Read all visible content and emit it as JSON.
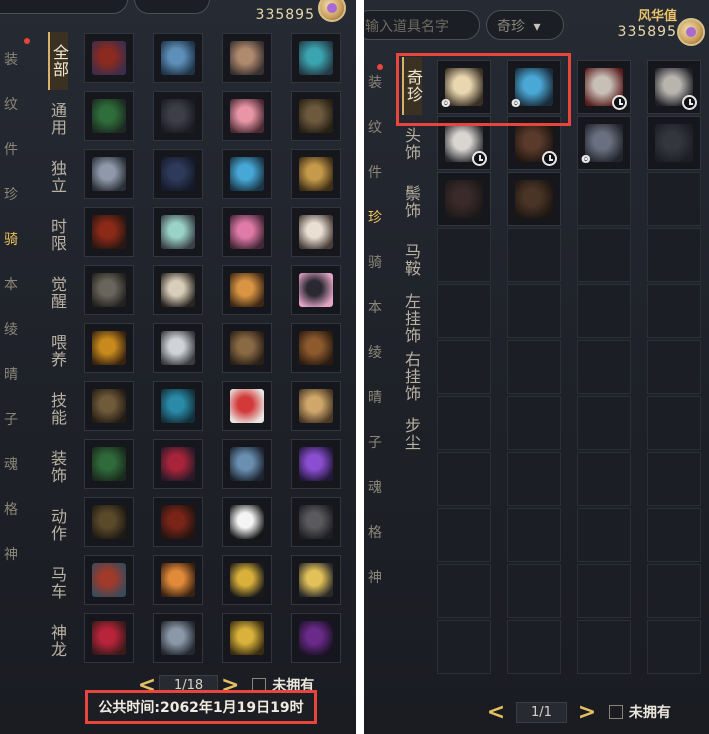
{
  "left": {
    "fengcai_value": "335895",
    "edge_labels": [
      "装",
      "纹",
      "件",
      "珍",
      "骑",
      "本",
      "绫",
      "晴",
      "子",
      "魂",
      "格",
      "神"
    ],
    "categories": [
      "全部",
      "通用",
      "独立",
      "时限",
      "觉醒",
      "喂养",
      "技能",
      "装饰",
      "动作",
      "马车",
      "神龙"
    ],
    "pager": {
      "prev": "<",
      "text": "1/18",
      "next": ">",
      "checkbox_label": "未拥有"
    },
    "public_time": "公共时间:2062年1月19日19时",
    "items": [
      {
        "icon": "mount-icon",
        "c1": "#8b2a1f",
        "c2": "#3d2d4a"
      },
      {
        "icon": "mount-icon",
        "c1": "#5e8fb8",
        "c2": "#20344a"
      },
      {
        "icon": "mount-icon",
        "c1": "#b08a6e",
        "c2": "#3a3030"
      },
      {
        "icon": "mount-icon",
        "c1": "#3aa5b0",
        "c2": "#243a46"
      },
      {
        "icon": "mount-icon",
        "c1": "#2f6e3a",
        "c2": "#1c2a22"
      },
      {
        "icon": "mount-icon",
        "c1": "#3d3f48",
        "c2": "#1a1b20"
      },
      {
        "icon": "mount-icon",
        "c1": "#e895a6",
        "c2": "#4a2a32"
      },
      {
        "icon": "mount-icon",
        "c1": "#6d5a3e",
        "c2": "#262014"
      },
      {
        "icon": "mount-icon",
        "c1": "#8f99aa",
        "c2": "#2b3038"
      },
      {
        "icon": "mount-icon",
        "c1": "#2e3a5a",
        "c2": "#151a28"
      },
      {
        "icon": "mount-icon",
        "c1": "#47a7d6",
        "c2": "#1a3646"
      },
      {
        "icon": "mount-icon",
        "c1": "#c59a4a",
        "c2": "#3e2e16"
      },
      {
        "icon": "mount-icon",
        "c1": "#8c2a18",
        "c2": "#2a1612"
      },
      {
        "icon": "mount-icon",
        "c1": "#9ad2c6",
        "c2": "#3a4248"
      },
      {
        "icon": "mount-icon",
        "c1": "#e07aa8",
        "c2": "#452636"
      },
      {
        "icon": "mount-icon",
        "c1": "#e9dfd2",
        "c2": "#4a3e3a"
      },
      {
        "icon": "mount-icon",
        "c1": "#6a655c",
        "c2": "#24221e"
      },
      {
        "icon": "mount-icon",
        "c1": "#d8cdb8",
        "c2": "#2a2622"
      },
      {
        "icon": "mount-icon",
        "c1": "#d99544",
        "c2": "#3e2814"
      },
      {
        "icon": "mount-icon",
        "c1": "#2a2830",
        "c2": "#e3a6c8"
      },
      {
        "icon": "mount-icon",
        "c1": "#c88a1c",
        "c2": "#3a2410"
      },
      {
        "icon": "mount-icon",
        "c1": "#cfd2d6",
        "c2": "#3a3c42"
      },
      {
        "icon": "mount-icon",
        "c1": "#8a6a44",
        "c2": "#2a2016"
      },
      {
        "icon": "mount-icon",
        "c1": "#8d5a2e",
        "c2": "#2c1c10"
      },
      {
        "icon": "mount-icon",
        "c1": "#6f5a3a",
        "c2": "#241c14"
      },
      {
        "icon": "mount-icon",
        "c1": "#2a8aa8",
        "c2": "#13303a"
      },
      {
        "icon": "mount-icon",
        "c1": "#d23a3a",
        "c2": "#e9e6e2"
      },
      {
        "icon": "mount-icon",
        "c1": "#cfa76a",
        "c2": "#4a3826"
      },
      {
        "icon": "mount-icon",
        "c1": "#2f6a3a",
        "c2": "#1a2a1c"
      },
      {
        "icon": "mount-icon",
        "c1": "#a8243a",
        "c2": "#2a1a28"
      },
      {
        "icon": "mount-icon",
        "c1": "#6a8fb0",
        "c2": "#1c2430"
      },
      {
        "icon": "mount-icon",
        "c1": "#8a4ed0",
        "c2": "#22183a"
      },
      {
        "icon": "mount-icon",
        "c1": "#5a4a2a",
        "c2": "#1e1a14"
      },
      {
        "icon": "mount-icon",
        "c1": "#7a2418",
        "c2": "#221410"
      },
      {
        "icon": "mount-icon",
        "c1": "#f4f4f4",
        "c2": "#161616"
      },
      {
        "icon": "mount-icon",
        "c1": "#5a5a5e",
        "c2": "#1e1e22"
      },
      {
        "icon": "mount-icon",
        "c1": "#a03a2a",
        "c2": "#3a4a5a"
      },
      {
        "icon": "mount-icon",
        "c1": "#e08a3a",
        "c2": "#3a2212"
      },
      {
        "icon": "mount-icon",
        "c1": "#d9b13a",
        "c2": "#1a1a1a"
      },
      {
        "icon": "mount-icon",
        "c1": "#e3c15a",
        "c2": "#2a2a2a"
      },
      {
        "icon": "mount-icon",
        "c1": "#b8243a",
        "c2": "#3a1a1a"
      },
      {
        "icon": "mount-icon",
        "c1": "#8a98a8",
        "c2": "#242830"
      },
      {
        "icon": "mount-icon",
        "c1": "#d8b23a",
        "c2": "#3a2e12"
      },
      {
        "icon": "mount-icon",
        "c1": "#6a2a8a",
        "c2": "#1c1226"
      }
    ]
  },
  "right": {
    "search_placeholder": "输入道具名字",
    "filter": "奇珍",
    "filter_arrow": "▾",
    "fengcai_label": "风华值",
    "fengcai_value": "335895",
    "edge_labels": [
      "装",
      "纹",
      "件",
      "珍",
      "骑",
      "本",
      "绫",
      "晴",
      "子",
      "魂",
      "格",
      "神"
    ],
    "categories": [
      "奇珍",
      "头饰",
      "鬃饰",
      "马鞍",
      "左挂饰",
      "右挂饰",
      "步尘"
    ],
    "pager": {
      "prev": "<",
      "text": "1/1",
      "next": ">",
      "checkbox_label": "未拥有"
    },
    "items": [
      {
        "icon": "horse-icon",
        "c1": "#e9d7b0",
        "c2": "#3a3024",
        "badge": "swirl"
      },
      {
        "icon": "horse-icon",
        "c1": "#4aa8d6",
        "c2": "#1a2c3a",
        "badge": "swirl"
      },
      {
        "icon": "horse-icon",
        "c1": "#c8c0b6",
        "c2": "#5a1e1e",
        "badge": "clock"
      },
      {
        "icon": "horse-icon",
        "c1": "#b8b4ae",
        "c2": "#1e2026",
        "badge": "clock"
      },
      {
        "icon": "horse-icon",
        "c1": "#d9d6d2",
        "c2": "#2a2a2e",
        "badge": "clock"
      },
      {
        "icon": "horse-icon",
        "c1": "#5a3a2a",
        "c2": "#1e1612",
        "badge": "clock"
      },
      {
        "icon": "horse-icon",
        "c1": "#6a7080",
        "c2": "#22252c",
        "badge": "swirl"
      },
      {
        "icon": "horse-icon",
        "c1": "#34363e",
        "c2": "#1c1e24",
        "badge": ""
      },
      {
        "icon": "horse-icon",
        "c1": "#3a2a2a",
        "c2": "#1c1818",
        "badge": ""
      },
      {
        "icon": "horse-icon",
        "c1": "#4a3426",
        "c2": "#1c1612",
        "badge": ""
      }
    ]
  }
}
